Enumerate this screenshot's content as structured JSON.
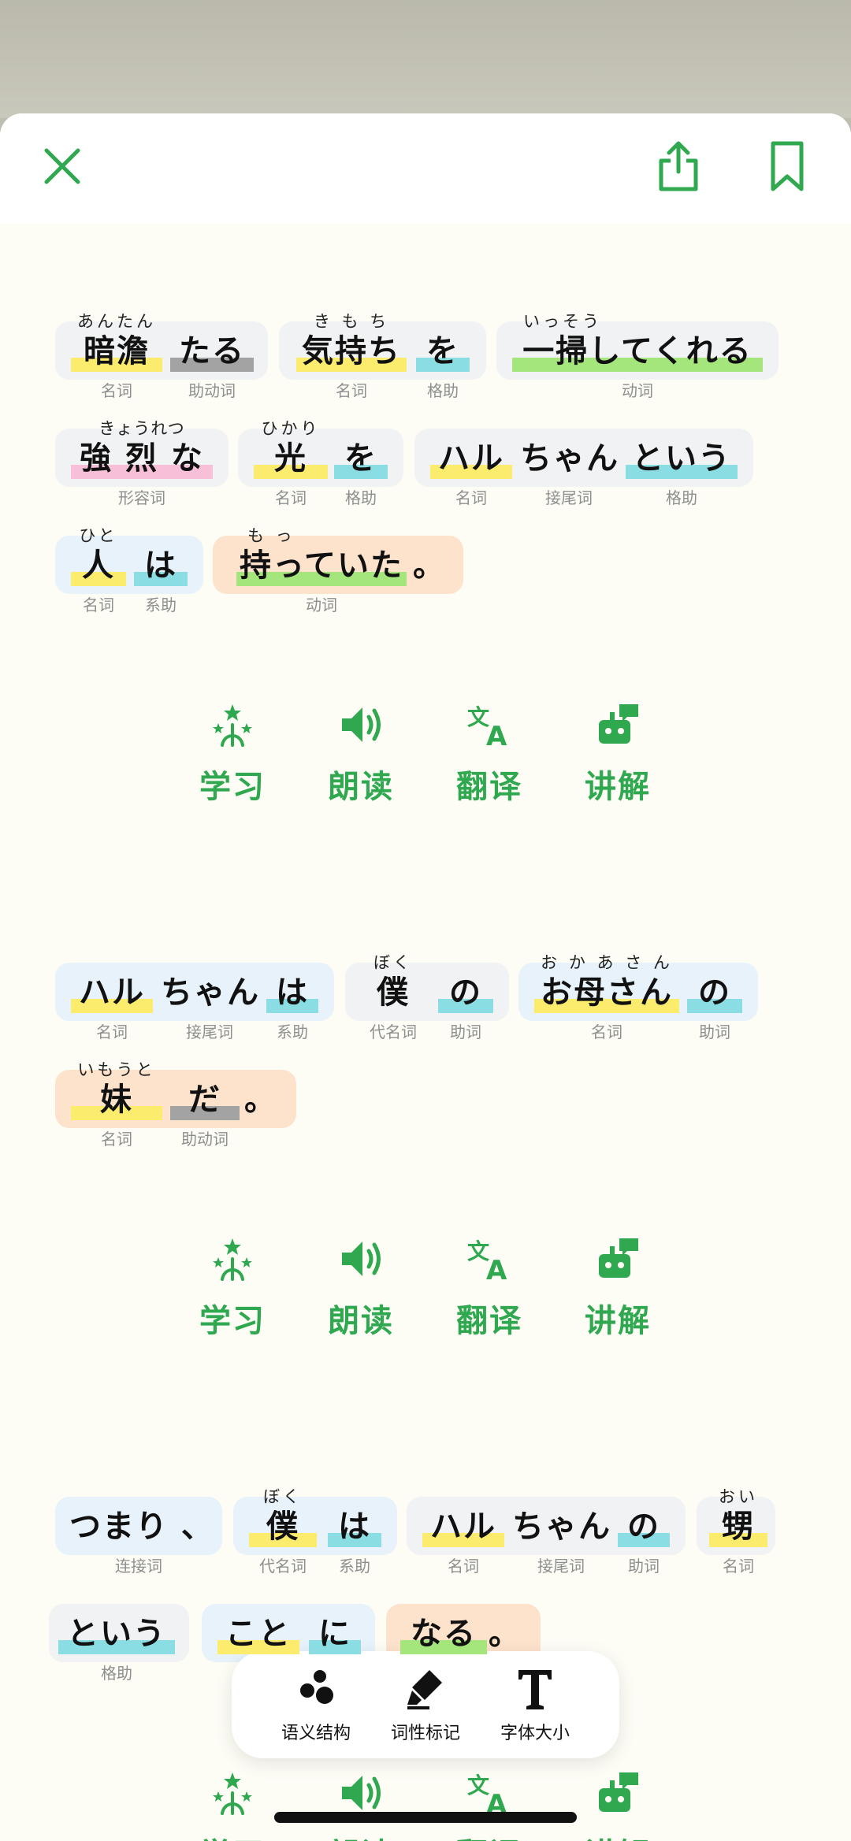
{
  "header": {
    "close_icon": "close-icon",
    "share_icon": "share-icon",
    "bookmark_icon": "bookmark-icon"
  },
  "colors": {
    "accent": "#2fa84f",
    "noun": "#fbec6e",
    "aux": "#a3a3a3",
    "particle": "#8adde3",
    "verb": "#a4e57c",
    "adjective": "#f8bfd9"
  },
  "sentence1": {
    "tokens": [
      {
        "furi": "あんたん",
        "word": "暗澹",
        "pos": "名词"
      },
      {
        "furi": "",
        "word": "たる",
        "pos": "助动词"
      },
      {
        "furi": "き も ち",
        "word": "気持ち",
        "pos": "名词"
      },
      {
        "furi": "",
        "word": "を",
        "pos": "格助"
      },
      {
        "furi": "いっそう",
        "word": "一掃してくれる",
        "pos": "动词"
      },
      {
        "furi": "きょうれつ",
        "word": "強 烈 な",
        "pos": "形容词"
      },
      {
        "furi": "ひかり",
        "word": "光",
        "pos": "名词"
      },
      {
        "furi": "",
        "word": "を",
        "pos": "格助"
      },
      {
        "furi": "",
        "word": "ハル",
        "pos": "名词"
      },
      {
        "furi": "",
        "word": "ちゃん",
        "pos": "接尾词"
      },
      {
        "furi": "",
        "word": "という",
        "pos": "格助"
      },
      {
        "furi": "ひと",
        "word": "人",
        "pos": "名词"
      },
      {
        "furi": "",
        "word": "は",
        "pos": "系助"
      },
      {
        "furi": "も っ",
        "word": "持っていた",
        "pos": "动词"
      }
    ],
    "end_punct": "。"
  },
  "sentence2": {
    "tokens": [
      {
        "furi": "",
        "word": "ハル",
        "pos": "名词"
      },
      {
        "furi": "",
        "word": "ちゃん",
        "pos": "接尾词"
      },
      {
        "furi": "",
        "word": "は",
        "pos": "系助"
      },
      {
        "furi": "ぼく",
        "word": "僕",
        "pos": "代名词"
      },
      {
        "furi": "",
        "word": "の",
        "pos": "助词"
      },
      {
        "furi": "お か あ さ ん",
        "word": "お母さん",
        "pos": "名词"
      },
      {
        "furi": "",
        "word": "の",
        "pos": "助词"
      },
      {
        "furi": "いもうと",
        "word": "妹",
        "pos": "名词"
      },
      {
        "furi": "",
        "word": "だ",
        "pos": "助动词"
      }
    ],
    "end_punct": "。"
  },
  "sentence3": {
    "tokens": [
      {
        "furi": "",
        "word": "つまり 、",
        "pos": "连接词"
      },
      {
        "furi": "ぼく",
        "word": "僕",
        "pos": "代名词"
      },
      {
        "furi": "",
        "word": "は",
        "pos": "系助"
      },
      {
        "furi": "",
        "word": "ハル",
        "pos": "名词"
      },
      {
        "furi": "",
        "word": "ちゃん",
        "pos": "接尾词"
      },
      {
        "furi": "",
        "word": "の",
        "pos": "助词"
      },
      {
        "furi": "おい",
        "word": "甥",
        "pos": "名词"
      },
      {
        "furi": "",
        "word": "という",
        "pos": "格助"
      },
      {
        "furi": "",
        "word": "こと",
        "pos": ""
      },
      {
        "furi": "",
        "word": "に",
        "pos": ""
      },
      {
        "furi": "",
        "word": "なる",
        "pos": ""
      }
    ],
    "end_punct": "。"
  },
  "actions": {
    "learn": "学习",
    "read": "朗读",
    "translate": "翻译",
    "explain": "讲解"
  },
  "toolbar": {
    "semantic": "语义结构",
    "pos_tag": "词性标记",
    "font_size": "字体大小"
  }
}
